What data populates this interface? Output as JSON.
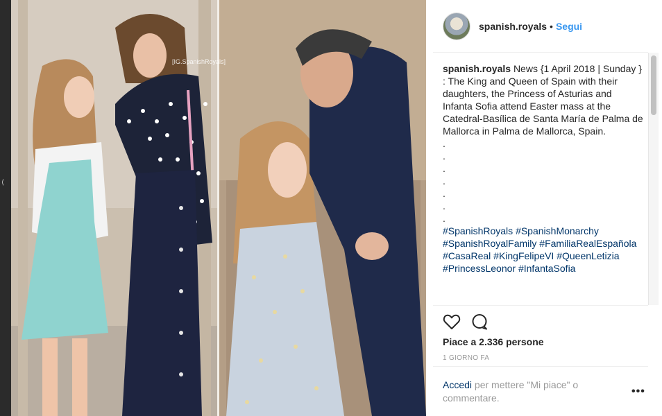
{
  "post": {
    "username": "spanish.royals",
    "follow_label": "Segui",
    "watermark": "[IG.SpanishRoyals]",
    "caption": "News {1 April 2018 | Sunday } : The King and Queen of Spain with their daughters, the Princess of Asturias and Infanta Sofia attend Easter mass at the Catedral-Basílica de Santa María de Palma de Mallorca in Palma de Mallorca, Spain.",
    "dots": [
      ".",
      ".",
      ".",
      ".",
      ".",
      ".",
      "."
    ],
    "hashtags": [
      "#SpanishRoyals",
      "#SpanishMonarchy",
      "#SpanishRoyalFamily",
      "#FamiliaRealEspañola",
      "#CasaReal",
      "#KingFelipeVI",
      "#QueenLetizia",
      "#PrincessLeonor",
      "#InfantaSofia"
    ],
    "likes_text": "Piace a 2.336 persone",
    "time_ago": "1 GIORNO FA",
    "login_link": "Accedi",
    "login_text": "per mettere \"Mi piace\" o commentare.",
    "more_label": "•••"
  },
  "colors": {
    "link": "#3897f0",
    "hashtag": "#003569",
    "text": "#262626",
    "muted": "#999999"
  },
  "icons": [
    "heart-icon",
    "comment-icon",
    "more-options-icon"
  ]
}
